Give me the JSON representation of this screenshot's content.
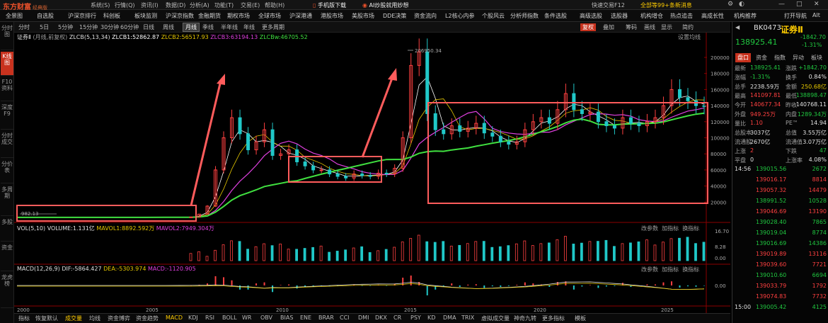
{
  "app": {
    "logo": "东方财富",
    "logo_sub": "经典版",
    "menus": [
      "系统(S)",
      "行情(Q)",
      "资讯(I)",
      "数据(D)",
      "分析(A)",
      "功能(T)",
      "交易(E)",
      "帮助(H)"
    ],
    "mobile_download": "手机版下载",
    "ai_promo": "AI炒股就用妙想",
    "shortcut": "快速交易F12",
    "messages": "全部等99+条新消息",
    "window_controls": [
      "—",
      "□",
      "✕"
    ]
  },
  "nav": {
    "items": [
      "全景图",
      "自选股",
      "沪深京排行",
      "科创板",
      "板块监测",
      "沪深京指数",
      "金融期货",
      "期权市场",
      "全球市场",
      "沪深港通",
      "港股市场",
      "美股市场",
      "DDE决策",
      "资金流向",
      "L2核心内参",
      "个股风云",
      "分析师指数",
      "条件选股",
      "高级选股",
      "选股器",
      "机构增仓",
      "热点追击",
      "高成长性",
      "机构推荐"
    ],
    "right_items": [
      "打开导航",
      "Alt"
    ]
  },
  "left_tabs": [
    {
      "label": "分时图",
      "active": false
    },
    {
      "label": "K线图",
      "active": true
    },
    {
      "label": "F10资料",
      "active": false
    },
    {
      "label": "深度F9",
      "active": false
    },
    {
      "label": "分时成交",
      "active": false
    },
    {
      "label": "分价表",
      "active": false
    },
    {
      "label": "多周期",
      "active": false
    },
    {
      "label": "多股",
      "active": false
    },
    {
      "label": "资金",
      "active": false
    },
    {
      "label": "龙虎榜",
      "active": false
    }
  ],
  "periods": [
    {
      "label": "分时",
      "active": false
    },
    {
      "label": "5日",
      "active": false
    },
    {
      "label": "5分钟",
      "active": false
    },
    {
      "label": "15分钟",
      "active": false
    },
    {
      "label": "30分钟",
      "active": false
    },
    {
      "label": "60分钟",
      "active": false
    },
    {
      "label": "日线",
      "active": false
    },
    {
      "label": "周线",
      "active": false
    },
    {
      "label": "月线",
      "active": true
    },
    {
      "label": "季线",
      "active": false
    },
    {
      "label": "半年线",
      "active": false
    },
    {
      "label": "年线",
      "active": false
    },
    {
      "label": "更多周期",
      "active": false
    }
  ],
  "right_tools": [
    {
      "label": "复权",
      "hl": true
    },
    {
      "label": "叠加",
      "hl": false
    },
    {
      "label": "筹码",
      "hl": false
    },
    {
      "label": "画线",
      "hl": false
    },
    {
      "label": "显示",
      "hl": false
    },
    {
      "label": "简约",
      "hl": false
    }
  ],
  "main_legend": {
    "name": "证券Ⅱ",
    "period_note": "(月线,前复权)",
    "zlcb": "ZLCB(5,13,34)",
    "zlcb1": "ZLCB1:52862.87",
    "zlcb2": "ZLCB2:56517.93",
    "zlcb3": "ZLCB3:63194.13",
    "zlcbw": "ZLCBw:46705.52",
    "settings": "设置均线"
  },
  "vol_legend": {
    "name": "VOL(5,10)",
    "volume": "VOLUME:1.131亿",
    "mavol1": "MAVOL1:8892.592万",
    "mavol2": "MAVOL2:7949.304万",
    "actions": [
      "改参数",
      "加指标",
      "换指标"
    ]
  },
  "macd_legend": {
    "name": "MACD(12,26,9)",
    "dif": "DIF:-5864.427",
    "dea": "DEA:-5303.974",
    "macd": "MACD:-1120.905",
    "actions": [
      "改参数",
      "加指标",
      "换指标"
    ]
  },
  "chart_data": {
    "type": "candlestick",
    "annotations": {
      "low_label": "982.13",
      "high_label": "206950.34"
    },
    "y_ticks": [
      "200000",
      "180000",
      "160000",
      "140000",
      "120000",
      "100000",
      "80000",
      "60000",
      "40000",
      "20000"
    ],
    "vol_ticks": [
      "16.70",
      "8.28",
      "0.00"
    ],
    "macd_ticks": [
      "0.00"
    ],
    "x_ticks": [
      "2000",
      "2005",
      "2010",
      "2015",
      "2020",
      "2025"
    ],
    "ylim": [
      0,
      215000
    ],
    "close_series": [
      982,
      990,
      1000,
      1010,
      1020,
      1030,
      1050,
      1100,
      1500,
      5000,
      15000,
      60000,
      100000,
      125000,
      105000,
      85000,
      95000,
      110000,
      78000,
      80000,
      85000,
      70000,
      65000,
      60000,
      60000,
      55000,
      52000,
      50000,
      55000,
      53000,
      52000,
      56000,
      55000,
      62000,
      100000,
      190000,
      206950,
      130000,
      110000,
      105000,
      115000,
      108000,
      112000,
      118000,
      106000,
      102000,
      95000,
      92000,
      95000,
      110000,
      120000,
      125000,
      118000,
      135000,
      155000,
      135000,
      130000,
      132000,
      120000,
      115000,
      112000,
      125000,
      118000,
      115000,
      120000,
      125000,
      140000,
      160000,
      150000,
      146000,
      140000,
      138925
    ]
  },
  "bottom_tabs": [
    {
      "label": "指标",
      "active": false
    },
    {
      "label": "恢复默认",
      "active": false
    },
    {
      "label": "成交量",
      "active": true
    },
    {
      "label": "均线",
      "active": false
    },
    {
      "label": "资金博弈",
      "active": false
    },
    {
      "label": "资金趋势",
      "active": false
    },
    {
      "label": "MACD",
      "active": true
    },
    {
      "label": "KDJ",
      "active": false
    },
    {
      "label": "RSI",
      "active": false
    },
    {
      "label": "BOLL",
      "active": false
    },
    {
      "label": "WR",
      "active": false
    },
    {
      "label": "OBV",
      "active": false
    },
    {
      "label": "BIAS",
      "active": false
    },
    {
      "label": "ENE",
      "active": false
    },
    {
      "label": "BRAR",
      "active": false
    },
    {
      "label": "CCI",
      "active": false
    },
    {
      "label": "DMI",
      "active": false
    },
    {
      "label": "DKX",
      "active": false
    },
    {
      "label": "CR",
      "active": false
    },
    {
      "label": "PSY",
      "active": false
    },
    {
      "label": "KD",
      "active": false
    },
    {
      "label": "DMA",
      "active": false
    },
    {
      "label": "TRIX",
      "active": false
    },
    {
      "label": "虚拟成交量",
      "active": false
    },
    {
      "label": "神奇九转",
      "active": false
    },
    {
      "label": "更多指标",
      "active": false
    },
    {
      "label": "模板",
      "active": false
    }
  ],
  "quote": {
    "code": "BK0473",
    "name": "证券Ⅱ",
    "price": "138925.41",
    "change": "-1842.70",
    "pct": "-1.31%",
    "tabs": [
      "盘口",
      "资金",
      "指数",
      "异动",
      "板块"
    ],
    "rows": [
      {
        "l1": "最新",
        "v1": "138925.41",
        "c1": "down",
        "l2": "涨跌",
        "v2": "+1842.70",
        "c2": "down"
      },
      {
        "l1": "涨幅",
        "v1": "-1.31%",
        "c1": "down",
        "l2": "换手",
        "v2": "0.84%",
        "c2": "wht"
      },
      {
        "l1": "总手",
        "v1": "2238.59万",
        "c1": "wht",
        "l2": "金额",
        "v2": "250.68亿",
        "c2": "yel"
      },
      {
        "l1": "最高",
        "v1": "141097.81",
        "c1": "up",
        "l2": "最低",
        "v2": "138898.47",
        "c2": "down"
      },
      {
        "l1": "今开",
        "v1": "140677.34",
        "c1": "up",
        "l2": "昨收",
        "v2": "140768.11",
        "c2": "wht"
      },
      {
        "l1": "外盘",
        "v1": "949.25万",
        "c1": "up",
        "l2": "内盘",
        "v2": "1289.34万",
        "c2": "down"
      },
      {
        "l1": "量比",
        "v1": "1.10",
        "c1": "up",
        "l2": "PE™",
        "v2": "14.94",
        "c2": "wht"
      },
      {
        "l1": "总股本",
        "v1": "3037亿",
        "c1": "wht",
        "l2": "总值",
        "v2": "3.55万亿",
        "c2": "wht"
      },
      {
        "l1": "流通股",
        "v1": "2670亿",
        "c1": "wht",
        "l2": "流通值",
        "v2": "3.07万亿",
        "c2": "wht"
      },
      {
        "l1": "上涨",
        "v1": "2",
        "c1": "up",
        "l2": "下跌",
        "v2": "47",
        "c2": "down"
      },
      {
        "l1": "平盘",
        "v1": "0",
        "c1": "wht",
        "l2": "上涨率",
        "v2": "4.08%",
        "c2": "wht"
      }
    ],
    "ticks": [
      {
        "t": "14:56",
        "p": "139015.56",
        "v": "2672",
        "c": "down"
      },
      {
        "t": "",
        "p": "139016.17",
        "v": "8814",
        "c": "up"
      },
      {
        "t": "",
        "p": "139057.32",
        "v": "14479",
        "c": "up"
      },
      {
        "t": "",
        "p": "138991.52",
        "v": "10528",
        "c": "down"
      },
      {
        "t": "",
        "p": "139046.69",
        "v": "13190",
        "c": "up"
      },
      {
        "t": "",
        "p": "139028.40",
        "v": "7865",
        "c": "down"
      },
      {
        "t": "",
        "p": "139019.04",
        "v": "8774",
        "c": "down"
      },
      {
        "t": "",
        "p": "139016.69",
        "v": "14386",
        "c": "down"
      },
      {
        "t": "",
        "p": "139019.89",
        "v": "13116",
        "c": "up"
      },
      {
        "t": "",
        "p": "139039.60",
        "v": "7721",
        "c": "up"
      },
      {
        "t": "",
        "p": "139010.60",
        "v": "6694",
        "c": "down"
      },
      {
        "t": "",
        "p": "139033.79",
        "v": "1792",
        "c": "up"
      },
      {
        "t": "",
        "p": "139074.83",
        "v": "7732",
        "c": "up"
      },
      {
        "t": "15:00",
        "p": "139005.42",
        "v": "4125",
        "c": "down"
      }
    ]
  },
  "colors": {
    "up": "#ff4040",
    "down": "#20c8c8",
    "green": "#20c840",
    "ma1": "#ffffff",
    "ma2": "#e6c800",
    "ma3": "#e040e0",
    "ma4": "#40e040",
    "box": "#ff5c5c"
  }
}
